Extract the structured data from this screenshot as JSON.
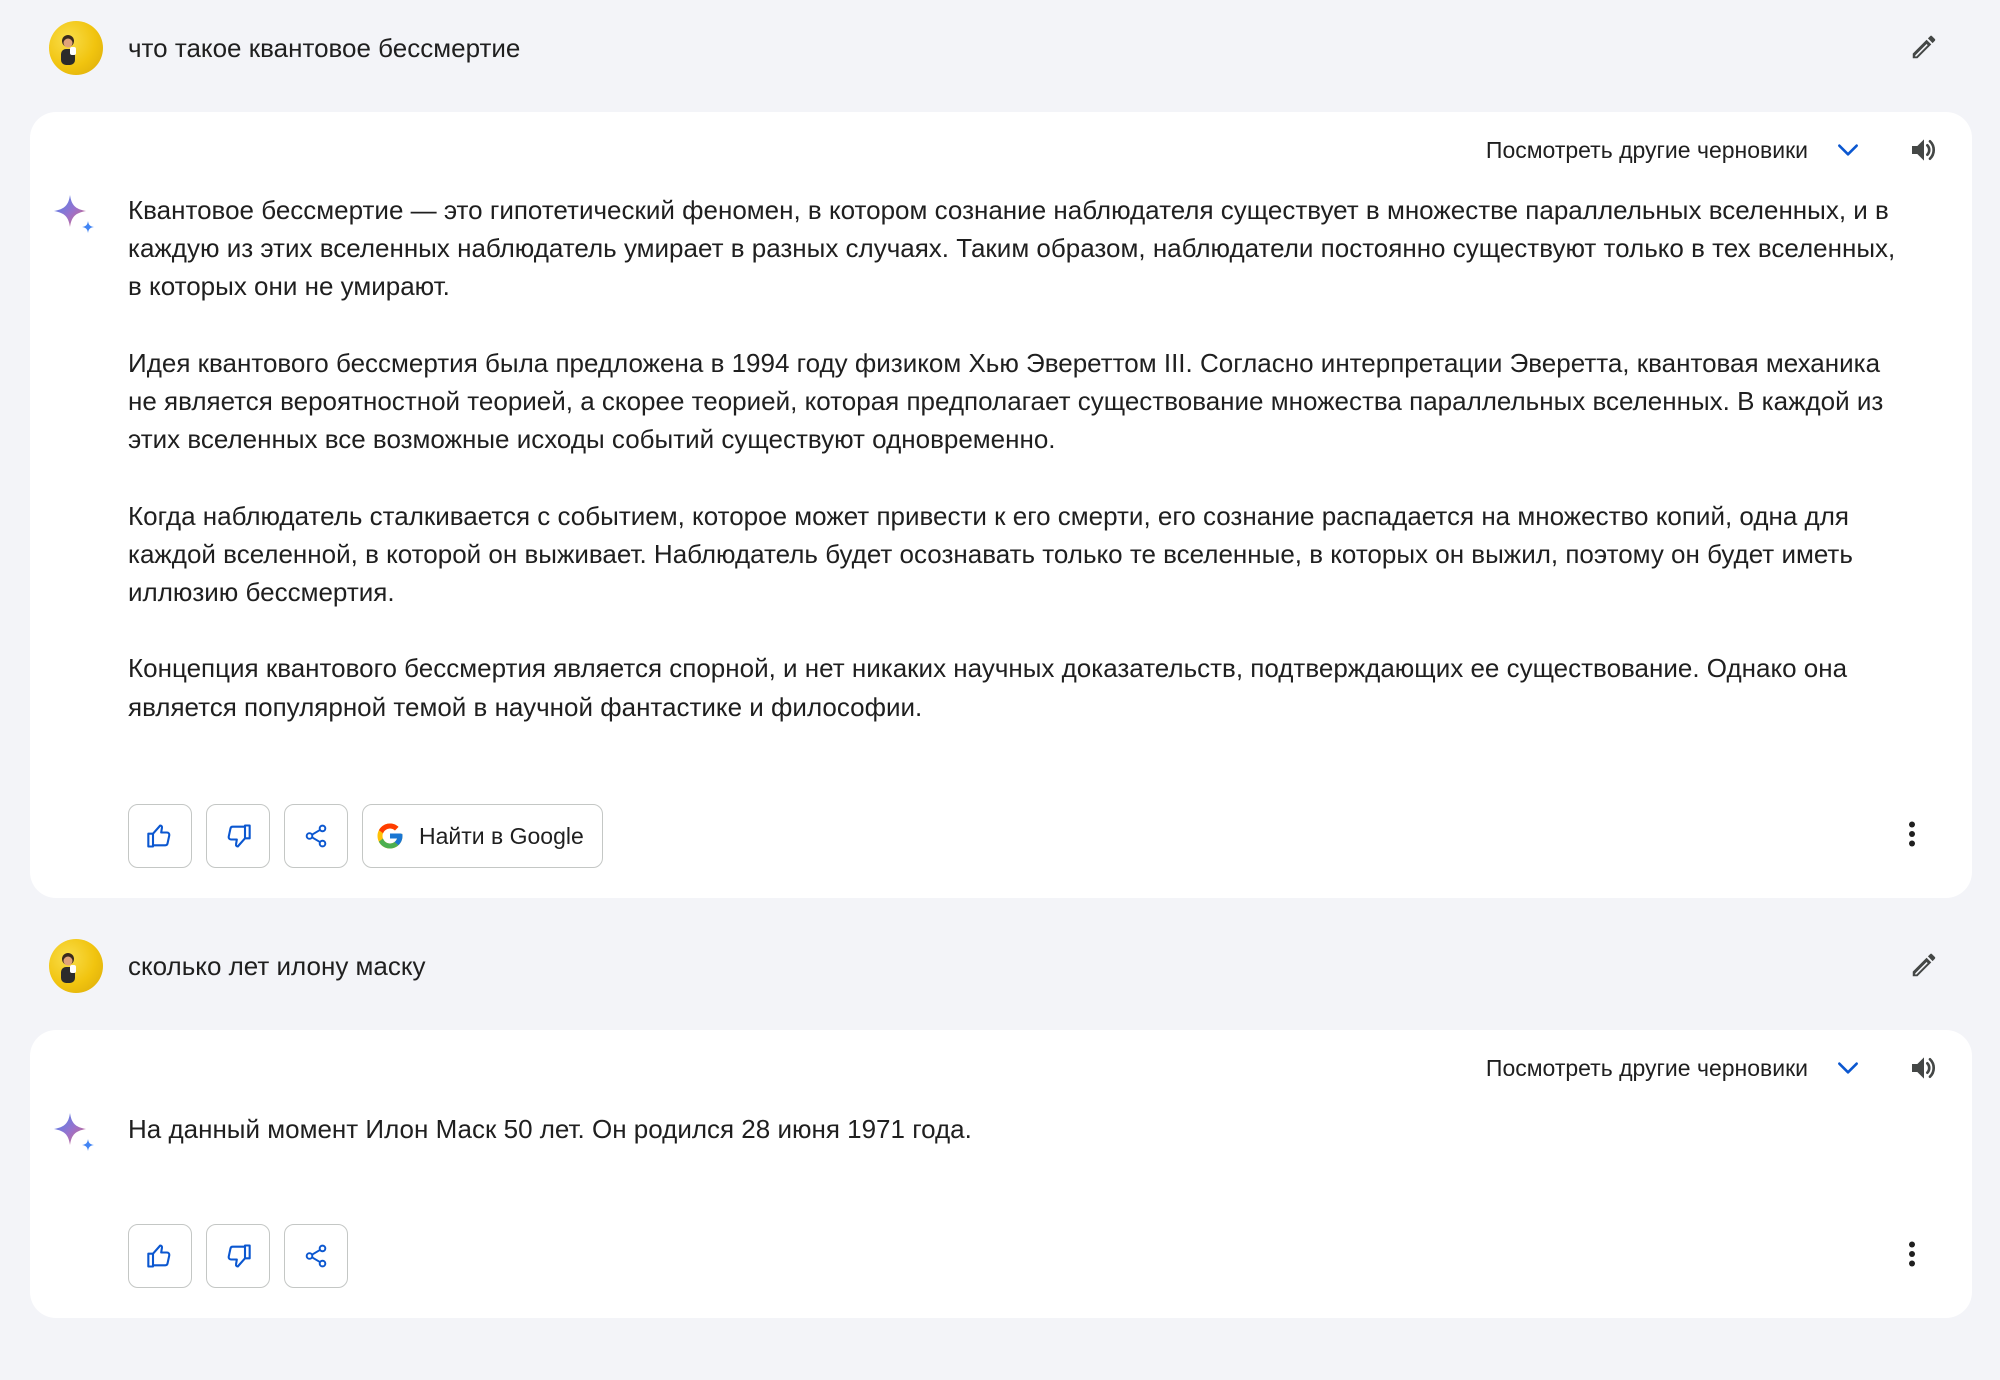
{
  "conversation": [
    {
      "prompt": "что такое квантовое бессмертие",
      "response": {
        "drafts_label": "Посмотреть другие черновики",
        "paragraphs": [
          "Квантовое бессмертие — это гипотетический феномен, в котором сознание наблюдателя существует в множестве параллельных вселенных, и в каждую из этих вселенных наблюдатель умирает в разных случаях. Таким образом, наблюдатели постоянно существуют только в тех вселенных, в которых они не умирают.",
          "Идея квантового бессмертия была предложена в 1994 году физиком Хью Эвереттом III. Согласно интерпретации Эверетта, квантовая механика не является вероятностной теорией, а скорее теорией, которая предполагает существование множества параллельных вселенных. В каждой из этих вселенных все возможные исходы событий существуют одновременно.",
          "Когда наблюдатель сталкивается с событием, которое может привести к его смерти, его сознание распадается на множество копий, одна для каждой вселенной, в которой он выживает. Наблюдатель будет осознавать только те вселенные, в которых он выжил, поэтому он будет иметь иллюзию бессмертия.",
          "Концепция квантового бессмертия является спорной, и нет никаких научных доказательств, подтверждающих ее существование. Однако она является популярной темой в научной фантастике и философии."
        ],
        "google_button_label": "Найти в Google"
      }
    },
    {
      "prompt": "сколько лет илону маску",
      "response": {
        "drafts_label": "Посмотреть другие черновики",
        "paragraphs": [
          "На данный момент Илон Маск 50 лет. Он родился 28 июня 1971 года."
        ]
      }
    }
  ],
  "icons": {
    "edit": "pencil-icon",
    "drafts_toggle": "chevron-down-icon",
    "read_aloud": "speaker-icon",
    "assistant": "sparkle-icon",
    "like": "thumbs-up-icon",
    "dislike": "thumbs-down-icon",
    "share": "share-icon",
    "google": "google-g-icon",
    "more": "more-vert-icon"
  },
  "colors": {
    "page_background": "#f3f4f8",
    "card_background": "#ffffff",
    "accent_blue": "#0b57d0",
    "text": "#1f1f1f",
    "avatar_yellow": "#f1c40f"
  }
}
